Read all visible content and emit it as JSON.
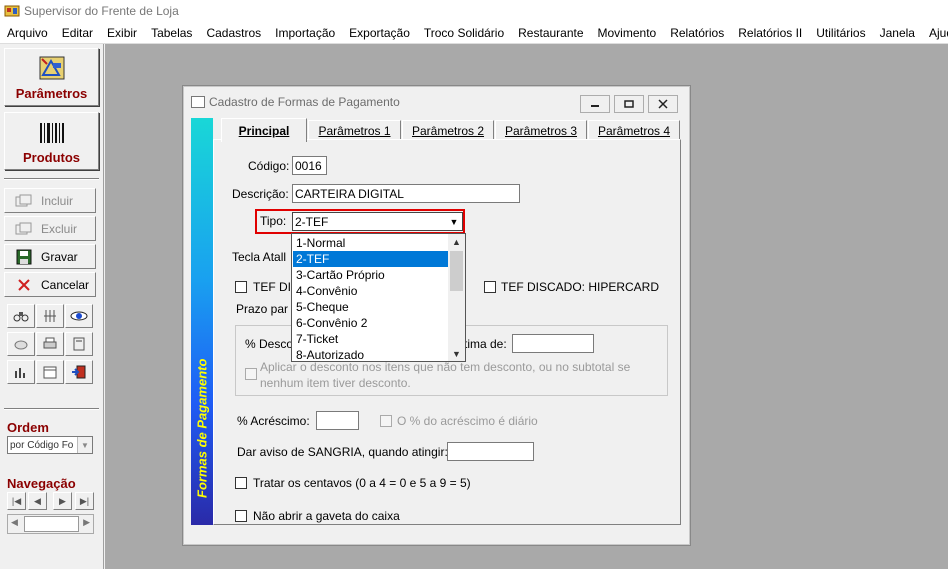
{
  "window": {
    "title": "Supervisor do Frente de Loja"
  },
  "menu": [
    "Arquivo",
    "Editar",
    "Exibir",
    "Tabelas",
    "Cadastros",
    "Importação",
    "Exportação",
    "Troco Solidário",
    "Restaurante",
    "Movimento",
    "Relatórios",
    "Relatórios II",
    "Utilitários",
    "Janela",
    "Ajuda"
  ],
  "sidebar": {
    "parametros_label": "Parâmetros",
    "produtos_label": "Produtos",
    "incluir_label": "Incluir",
    "excluir_label": "Excluir",
    "gravar_label": "Gravar",
    "cancelar_label": "Cancelar",
    "ordem_label": "Ordem",
    "ordem_value": "por Código Fo",
    "navegacao_label": "Navegação"
  },
  "dialog": {
    "title": "Cadastro de Formas de Pagamento",
    "side_text": "Formas de Pagamento",
    "tabs": [
      "Principal",
      "Parâmetros 1",
      "Parâmetros 2",
      "Parâmetros 3",
      "Parâmetros 4"
    ],
    "codigo_label": "Código:",
    "codigo_value": "0016",
    "descricao_label": "Descrição:",
    "descricao_value": "CARTEIRA DIGITAL",
    "tipo_label": "Tipo:",
    "tipo_value": "2-TEF",
    "tipo_options": [
      "1-Normal",
      "2-TEF",
      "3-Cartão Próprio",
      "4-Convênio",
      "5-Cheque",
      "6-Convênio 2",
      "7-Ticket",
      "8-Autorizado"
    ],
    "tipo_selected_index": 1,
    "tecla_label": "Tecla Atall",
    "tef_di_label": "TEF DI",
    "tef_discado_label": "TEF DISCADO: HIPERCARD",
    "prazo_label": "Prazo par",
    "desconto_label": "% Desco",
    "minima_label": "tima de:",
    "aplicar_line1": "Aplicar o desconto nos itens que não tem desconto, ou no subtotal se",
    "aplicar_line2": "nenhum item tiver desconto.",
    "acrescimo_label": "% Acréscimo:",
    "acrescimo_diario_label": "O % do acréscimo é diário",
    "sangria_label": "Dar aviso de SANGRIA, quando atingir:",
    "centavos_label": "Tratar os centavos (0 a 4 = 0    e    5 a 9 = 5)",
    "gaveta_label": "Não abrir a gaveta do caixa"
  }
}
